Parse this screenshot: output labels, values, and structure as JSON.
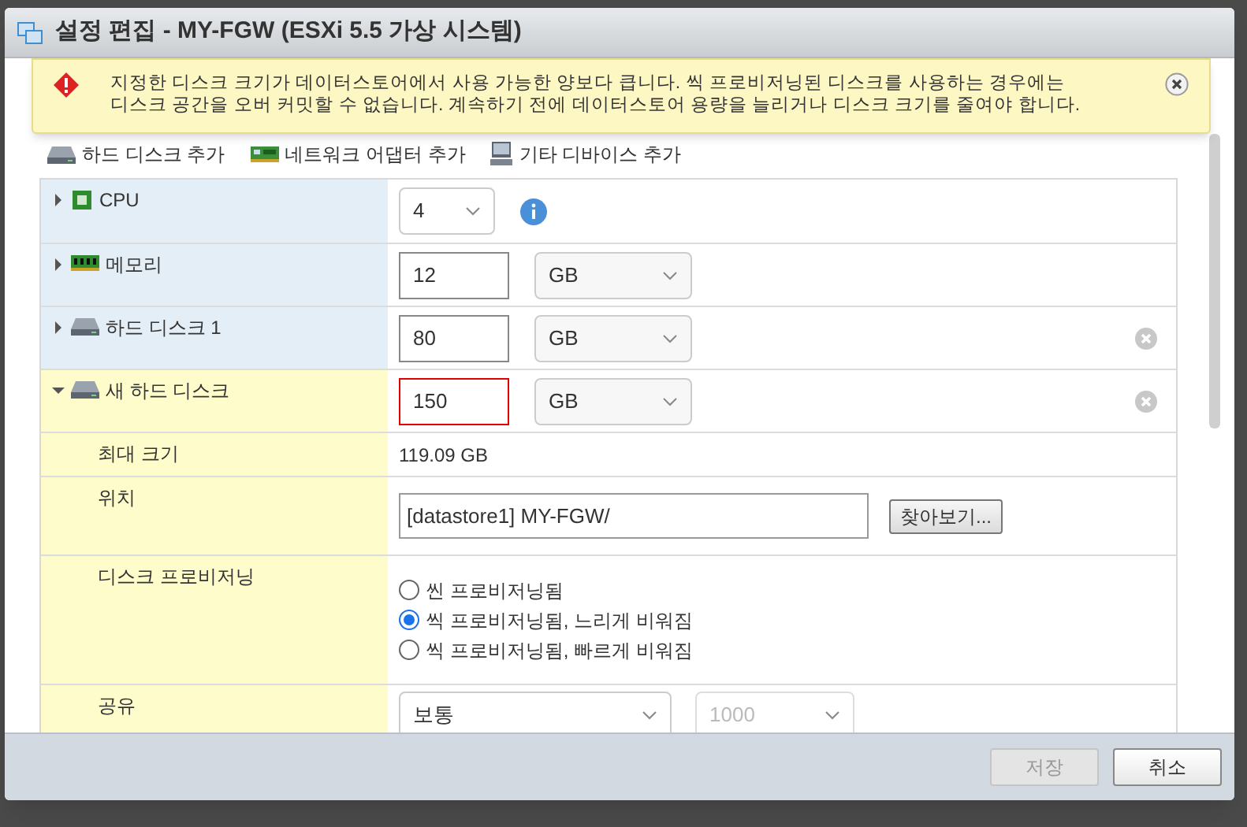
{
  "window": {
    "title": "설정 편집 - MY-FGW (ESXi 5.5 가상 시스템)"
  },
  "warning": {
    "text": "지정한 디스크 크기가 데이터스토어에서 사용 가능한 양보다 큽니다. 씩 프로비저닝된 디스크를 사용하는 경우에는 디스크 공간을 오버 커밋할 수 없습니다. 계속하기 전에 데이터스토어 용량을 늘리거나 디스크 크기를 줄여야 합니다."
  },
  "toolbar": [
    {
      "label": "하드 디스크 추가",
      "kind": "disk"
    },
    {
      "label": "네트워크 어댑터 추가",
      "kind": "nic"
    },
    {
      "label": "기타 디바이스 추가",
      "kind": "device"
    }
  ],
  "rows": [
    {
      "kind": "cpu",
      "label": "CPU",
      "expanded": false,
      "select": "4",
      "info": true,
      "removable": false,
      "new": false
    },
    {
      "kind": "memory",
      "label": "메모리",
      "expanded": false,
      "value": "12",
      "unit": "GB",
      "removable": false,
      "new": false,
      "invalid": false
    },
    {
      "kind": "disk",
      "label": "하드 디스크 1",
      "expanded": false,
      "value": "80",
      "unit": "GB",
      "removable": true,
      "new": false,
      "invalid": false
    },
    {
      "kind": "disk",
      "label": "새 하드 디스크",
      "expanded": true,
      "value": "150",
      "unit": "GB",
      "removable": true,
      "new": true,
      "invalid": true
    },
    {
      "kind": "text",
      "label": "최대 크기",
      "value": "119.09 GB"
    },
    {
      "kind": "location",
      "label": "위치",
      "value": "[datastore1] MY-FGW/",
      "button": "찾아보기..."
    },
    {
      "kind": "radio",
      "label": "디스크 프로비저닝",
      "options": [
        {
          "label": "씬 프로비저닝됨",
          "selected": false
        },
        {
          "label": "씩 프로비저닝됨, 느리게 비워짐",
          "selected": true
        },
        {
          "label": "씩 프로비저닝됨, 빠르게 비워짐",
          "selected": false
        }
      ]
    },
    {
      "kind": "share",
      "label": "공유",
      "select": "보통",
      "select2": "1000"
    }
  ],
  "buttons": [
    {
      "label": "저장",
      "disabled": true
    },
    {
      "label": "취소",
      "disabled": false
    }
  ]
}
